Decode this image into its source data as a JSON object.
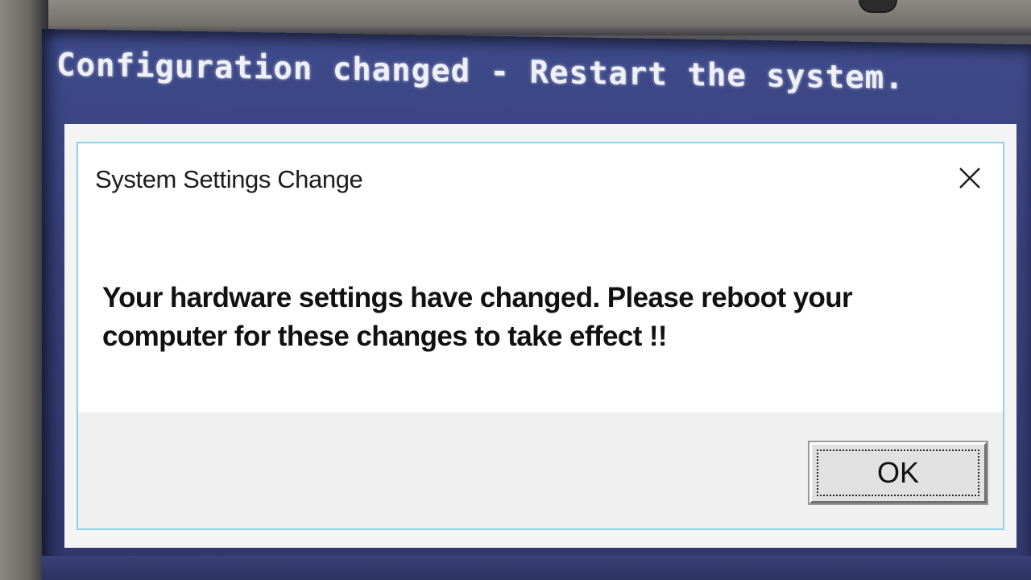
{
  "bios": {
    "message": "Configuration changed - Restart the system."
  },
  "dialog": {
    "title": "System Settings Change",
    "close_icon": "close-icon",
    "message_line1": "Your hardware settings have changed. Please reboot your",
    "message_line2": "computer for these changes to take effect !!",
    "ok_label": "OK"
  },
  "colors": {
    "screen_blue": "#37407a",
    "dialog_border": "#8fd0ea",
    "footer_gray": "#f0f0f0"
  }
}
